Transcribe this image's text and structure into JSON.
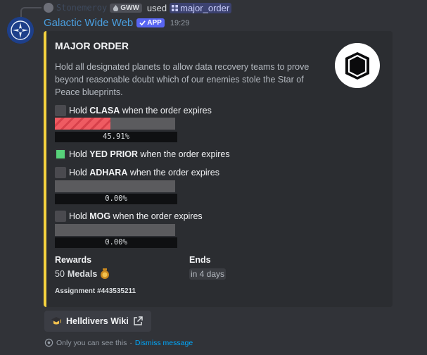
{
  "reply": {
    "username": "Stonemeroy",
    "guild_tag": "GWW",
    "used_text": "used",
    "command": "major_order"
  },
  "message": {
    "bot_name": "Galactic Wide Web",
    "app_tag": "APP",
    "time": "19:29"
  },
  "embed": {
    "accent_color": "#f5d23e",
    "title": "MAJOR ORDER",
    "description": "Hold all designated planets to allow data recovery teams to prove beyond reasonable doubt which of our enemies stole the Star of Peace blueprints.",
    "objectives": [
      {
        "prefix": "Hold ",
        "planet": "CLASA",
        "suffix": " when the order expires",
        "completed": false,
        "progress_label": "45.91%",
        "progress": 45.91
      },
      {
        "prefix": "Hold ",
        "planet": "YED PRIOR",
        "suffix": " when the order expires",
        "completed": true
      },
      {
        "prefix": "Hold ",
        "planet": "ADHARA",
        "suffix": " when the order expires",
        "completed": false,
        "progress_label": "0.00%",
        "progress": 0.0
      },
      {
        "prefix": "Hold ",
        "planet": "MOG",
        "suffix": " when the order expires",
        "completed": false,
        "progress_label": "0.00%",
        "progress": 0.0
      }
    ],
    "rewards": {
      "label": "Rewards",
      "amount": "50",
      "item": "Medals",
      "icon": "medal-icon"
    },
    "ends": {
      "label": "Ends",
      "value": "in 4 days"
    },
    "footer": "Assignment #443535211"
  },
  "button": {
    "label": "Helldivers Wiki",
    "icon": "graduation-cap-icon",
    "trailing_icon": "external-link-icon"
  },
  "ephemeral": {
    "text": "Only you can see this",
    "separator": "·",
    "link": "Dismiss message"
  }
}
